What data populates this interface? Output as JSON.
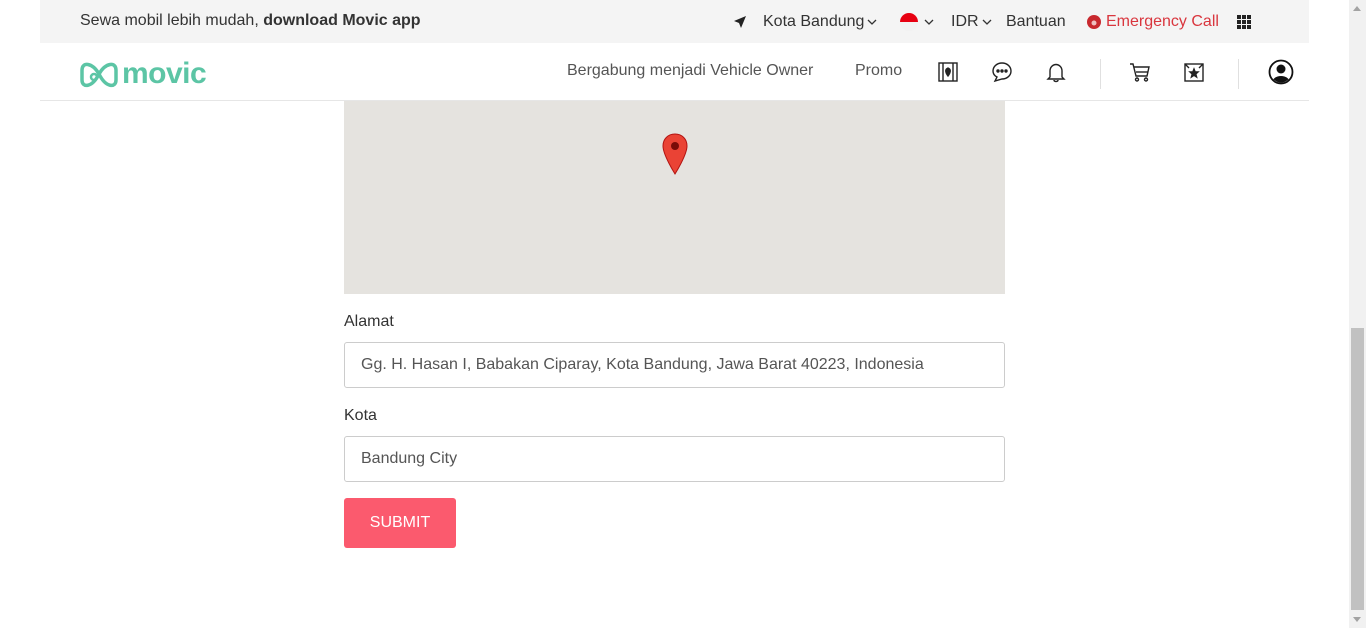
{
  "topbar": {
    "promo_prefix": "Sewa mobil lebih mudah, ",
    "promo_bold": "download Movic app",
    "city": "Kota Bandung",
    "currency": "IDR",
    "help": "Bantuan",
    "emergency": "Emergency Call"
  },
  "nav": {
    "logo": "movic",
    "join_owner": "Bergabung menjadi Vehicle Owner",
    "promo": "Promo",
    "icons": [
      "map-icon",
      "chat-icon",
      "bell-icon",
      "cart-icon",
      "favorite-icon",
      "user-icon"
    ]
  },
  "form": {
    "address_label": "Alamat",
    "address_value": "Gg. H. Hasan I, Babakan Ciparay, Kota Bandung, Jawa Barat 40223, Indonesia",
    "city_label": "Kota",
    "city_value": "Bandung City",
    "submit": "SUBMIT"
  },
  "colors": {
    "brand": "#5cc5a5",
    "submit": "#fb5a6e",
    "emergency": "#d9363e",
    "map_bg": "#e5e3df",
    "pin": "#ea4335"
  }
}
